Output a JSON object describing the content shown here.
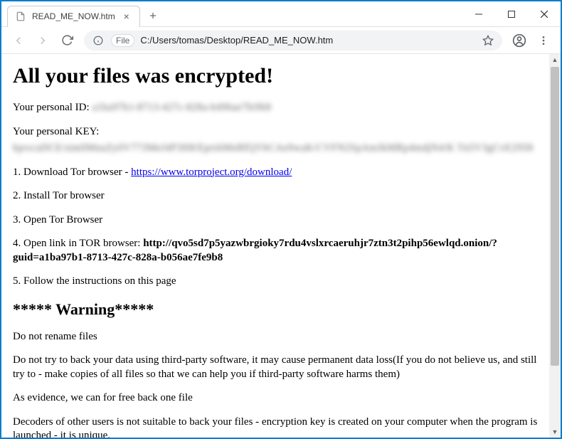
{
  "tab": {
    "title": "READ_ME_NOW.htm"
  },
  "addressbar": {
    "file_chip": "File",
    "url": "C:/Users/tomas/Desktop/READ_ME_NOW.htm"
  },
  "page": {
    "heading": "All your files was encrypted!",
    "personal_id_label": "Your personal ID: ",
    "personal_id_value": "a1ba97b1-8713-427c-828a-b496ae7fe9b8",
    "personal_key_label": "Your personal KEY:",
    "personal_key_value": "hpvs/aDCE/sim0MnuZy0V773MeJ4P3H8/EprsbMeBfQVbCAe9waK/CVFN2SpAmJkMRp4mdjN4/K Tn5V3gCvE2958",
    "step1_prefix": "1. Download Tor browser - ",
    "step1_link": "https://www.torproject.org/download/",
    "step2": "2. Install Tor browser",
    "step3": "3. Open Tor Browser",
    "step4_prefix": "4. Open link in TOR browser: ",
    "step4_url": "http://qvo5sd7p5yazwbrgioky7rdu4vslxrcaeruhjr7ztn3t2pihp56ewlqd.onion/?guid=a1ba97b1-8713-427c-828a-b056ae7fe9b8",
    "step5": "5. Follow the instructions on this page",
    "warning_heading": "***** Warning*****",
    "warn1": "Do not rename files",
    "warn2": "Do not try to back your data using third-party software, it may cause permanent data loss(If you do not believe us, and still try to - make copies of all files so that we can help you if third-party software harms them)",
    "warn3": "As evidence, we can for free back one file",
    "warn4": "Decoders of other users is not suitable to back your files - encryption key is created on your computer when the program is launched - it is unique."
  }
}
